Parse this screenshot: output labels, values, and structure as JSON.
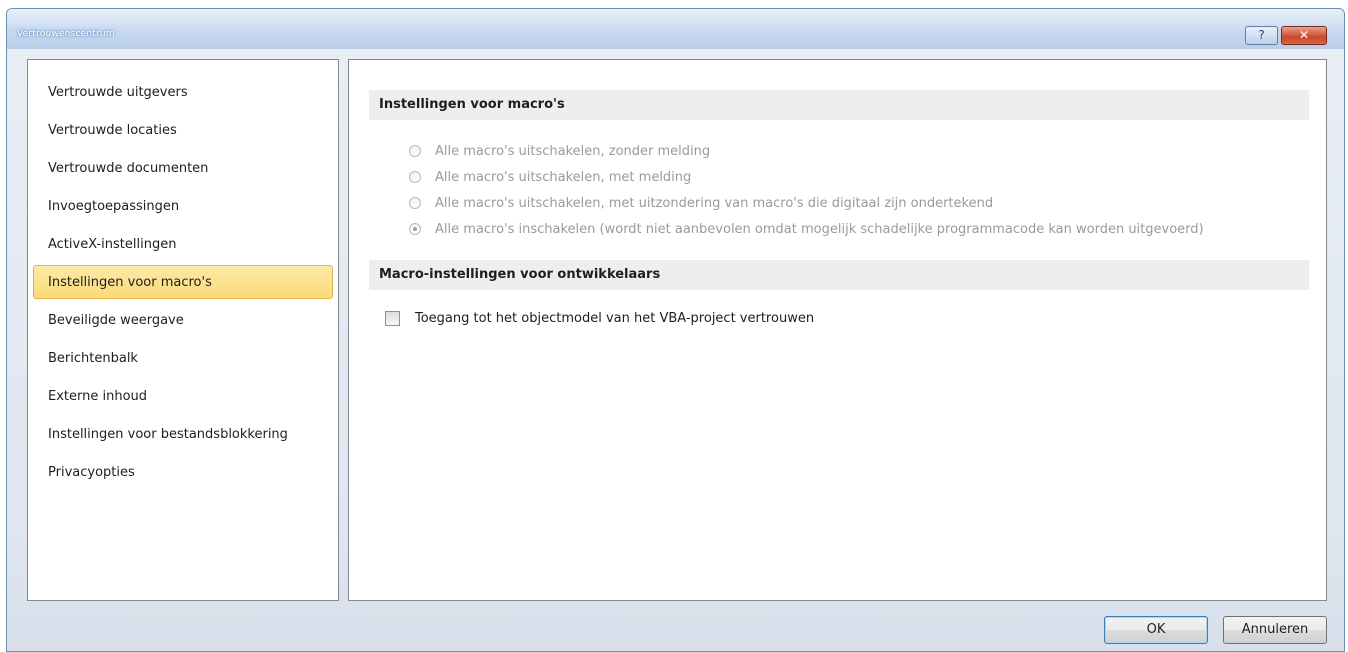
{
  "window": {
    "title": "Vertrouwenscentrum",
    "help_label": "?",
    "close_label": "✕"
  },
  "sidebar": {
    "items": [
      {
        "label": "Vertrouwde uitgevers",
        "selected": false
      },
      {
        "label": "Vertrouwde locaties",
        "selected": false
      },
      {
        "label": "Vertrouwde documenten",
        "selected": false
      },
      {
        "label": "Invoegtoepassingen",
        "selected": false
      },
      {
        "label": "ActiveX-instellingen",
        "selected": false
      },
      {
        "label": "Instellingen voor macro's",
        "selected": true
      },
      {
        "label": "Beveiligde weergave",
        "selected": false
      },
      {
        "label": "Berichtenbalk",
        "selected": false
      },
      {
        "label": "Externe inhoud",
        "selected": false
      },
      {
        "label": "Instellingen voor bestandsblokkering",
        "selected": false
      },
      {
        "label": "Privacyopties",
        "selected": false
      }
    ]
  },
  "macro_settings": {
    "header": "Instellingen voor macro's",
    "options": [
      {
        "label": "Alle macro's uitschakelen, zonder melding",
        "checked": false
      },
      {
        "label": "Alle macro's uitschakelen, met melding",
        "checked": false
      },
      {
        "label": "Alle macro's uitschakelen, met uitzondering van macro's die digitaal zijn ondertekend",
        "checked": false
      },
      {
        "label": "Alle macro's inschakelen (wordt niet aanbevolen omdat mogelijk schadelijke programmacode kan worden uitgevoerd)",
        "checked": true
      }
    ]
  },
  "developer_settings": {
    "header": "Macro-instellingen voor ontwikkelaars",
    "vba_trust_label": "Toegang tot het objectmodel van het VBA-project vertrouwen",
    "vba_trust_checked": false
  },
  "buttons": {
    "ok_label": "OK",
    "cancel_label": "Annuleren"
  },
  "colors": {
    "selected_item_bg": "#fbd977",
    "selected_item_border": "#e2b44c",
    "section_header_bg": "#eeeef0",
    "disabled_text": "#9a9a9a"
  }
}
